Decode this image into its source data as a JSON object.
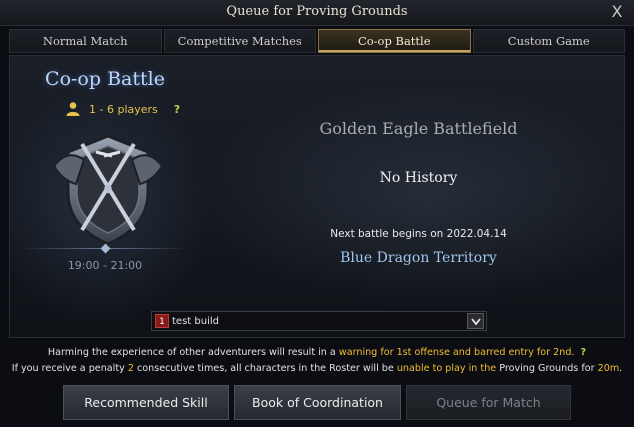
{
  "window": {
    "title": "Queue for Proving Grounds",
    "close_label": "X"
  },
  "tabs": [
    {
      "label": "Normal Match"
    },
    {
      "label": "Competitive Matches"
    },
    {
      "label": "Co-op Battle",
      "active": true
    },
    {
      "label": "Custom Game"
    }
  ],
  "mode": {
    "title": "Co-op Battle",
    "players": "1 - 6 players",
    "help": "?",
    "time": "19:00 - 21:00",
    "emblem_icon": "crossed-swords-shield-icon"
  },
  "battle": {
    "battlefield": "Golden Eagle Battlefield",
    "history": "No History",
    "next_battle": "Next battle begins on 2022.04.14",
    "territory": "Blue Dragon Territory"
  },
  "build_select": {
    "badge": "1",
    "value": "test build"
  },
  "notice": {
    "l1_a": "Harming the experience of other adventurers will result in a ",
    "l1_b": "warning for 1st offense and barred entry for 2nd.",
    "l1_help": "?",
    "l2_a": "If you receive a penalty ",
    "l2_b": "2",
    "l2_c": " consecutive times, all characters in the Roster will be ",
    "l2_d": "unable to play in the",
    "l2_e": " Proving Grounds for ",
    "l2_f": "20m",
    "l2_g": "."
  },
  "buttons": {
    "recommended": "Recommended Skill",
    "coordination": "Book of Coordination",
    "queue": "Queue for Match"
  },
  "colors": {
    "accent_gold": "#c6a45c",
    "highlight": "#f0bd35",
    "title_blue": "#b9d7ff"
  }
}
